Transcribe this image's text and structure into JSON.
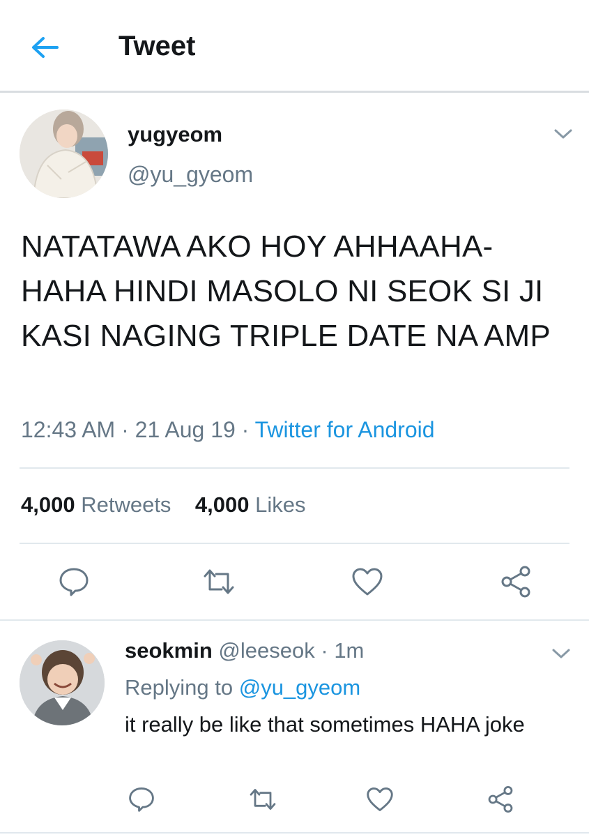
{
  "header": {
    "title": "Tweet",
    "back_icon": "back-arrow-icon"
  },
  "main_tweet": {
    "display_name": "yugyeom",
    "handle": "@yu_gyeom",
    "text": "NATATAWA AKO HOY AHHAAHA-HAHA HINDI MASOLO NI SEOK SI JI KASI NAGING TRIPLE DATE NA AMP",
    "time": "12:43 AM",
    "date": "21 Aug 19",
    "source": "Twitter for Android",
    "retweets_count": "4,000",
    "retweets_label": "Retweets",
    "likes_count": "4,000",
    "likes_label": "Likes"
  },
  "reply_tweet": {
    "display_name": "seokmin",
    "handle": "@leeseok",
    "time_ago": "1m",
    "replying_label": "Replying to",
    "replying_to": "@yu_gyeom",
    "text": "it really be like that sometimes HAHA joke"
  },
  "colors": {
    "accent": "#1b95e0",
    "secondary_text": "#657786",
    "primary_text": "#14171a",
    "divider": "#e1e8ed"
  }
}
